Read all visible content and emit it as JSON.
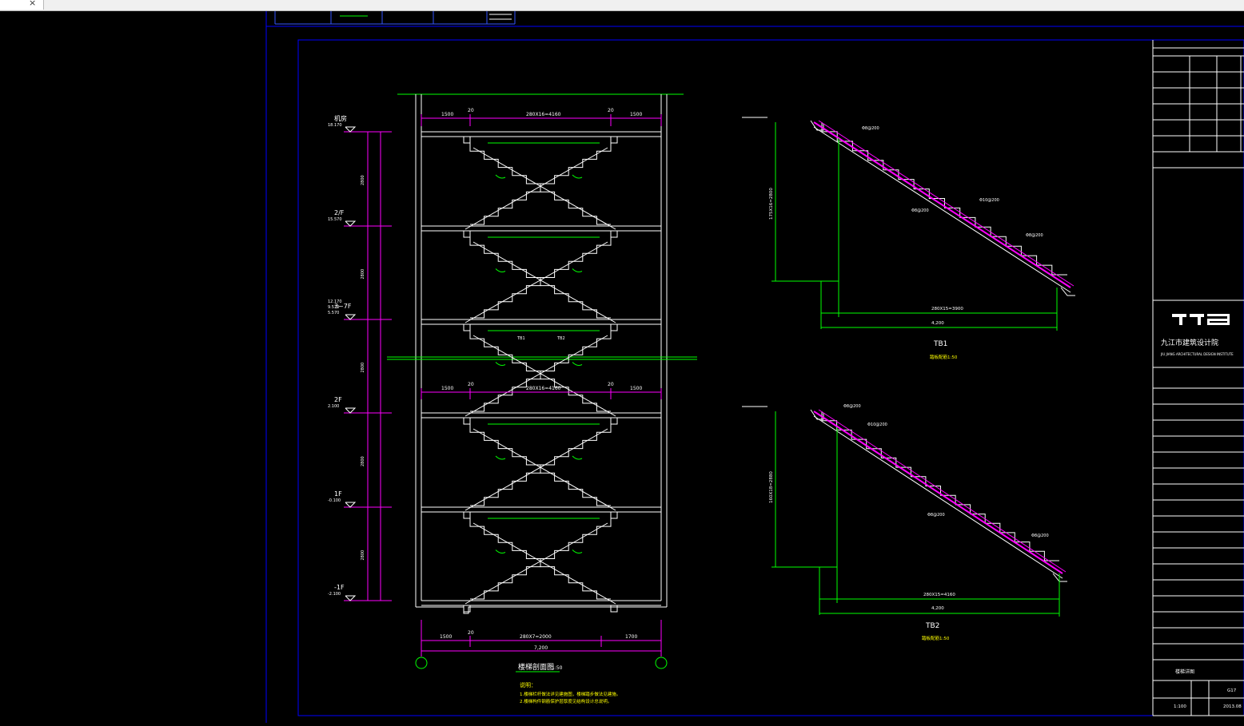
{
  "tab": {
    "close_label": "×"
  },
  "colors": {
    "background": "#000000",
    "white": "#ffffff",
    "green": "#00ff00",
    "magenta": "#ff00ff",
    "yellow": "#ffff00",
    "frame": "#0000ff"
  },
  "section": {
    "title": "楼梯剖面图",
    "scale": "1:50",
    "dims_top": [
      "1500",
      "20",
      "280X16=4160",
      "20",
      "1500"
    ],
    "dims_mid": [
      "1500",
      "20",
      "280X16=4160",
      "20",
      "1500"
    ],
    "dims_bottom": [
      "1500",
      "20",
      "280X7=2000",
      "1700"
    ],
    "total_bottom": "7,200",
    "stair_labels": [
      "TB1",
      "TB2"
    ],
    "levels": [
      {
        "name": "机房",
        "elev": "18.170"
      },
      {
        "name": "2/F",
        "elev": "15.570"
      },
      {
        "name": "3~7F",
        "elev": "12.170\n9.570\n5.570"
      },
      {
        "name": "2F",
        "elev": "2.100"
      },
      {
        "name": "1F",
        "elev": "-0.100"
      },
      {
        "name": "-1F",
        "elev": "-2.100"
      }
    ],
    "heights": [
      "2800",
      "2800",
      "2800",
      "2800",
      "2800"
    ],
    "notes_title": "说明：",
    "notes": [
      "1.楼梯栏杆做法详见建施图，楼梯踏步做法见建施。",
      "2.楼梯构件钢筋保护层厚度见结构设计总说明。"
    ]
  },
  "tb1": {
    "label": "TB1",
    "scale": "踏板配筋1:50",
    "height_dim": "175X16=2800",
    "run_dim": "280X15=3900",
    "total": "4,200",
    "rebar": [
      "Φ8@200",
      "Φ10@200",
      "Φ8@200",
      "Φ8@200"
    ]
  },
  "tb2": {
    "label": "TB2",
    "scale": "踏板配筋1:50",
    "height_dim": "160X18=2880",
    "run_dim": "280X15=4160",
    "total": "4,200",
    "rebar": [
      "Φ8@200",
      "Φ10@200",
      "Φ8@200",
      "Φ8@200"
    ]
  },
  "titleblock": {
    "firm_cn": "九江市建筑设计院",
    "firm_en": "JIU JIANG ARCHITECTURAL DESIGN INSTITUTE",
    "sheet_no": "G17",
    "date": "2013.08",
    "drawing_name": "楼梯详图",
    "scale": "1:100"
  }
}
